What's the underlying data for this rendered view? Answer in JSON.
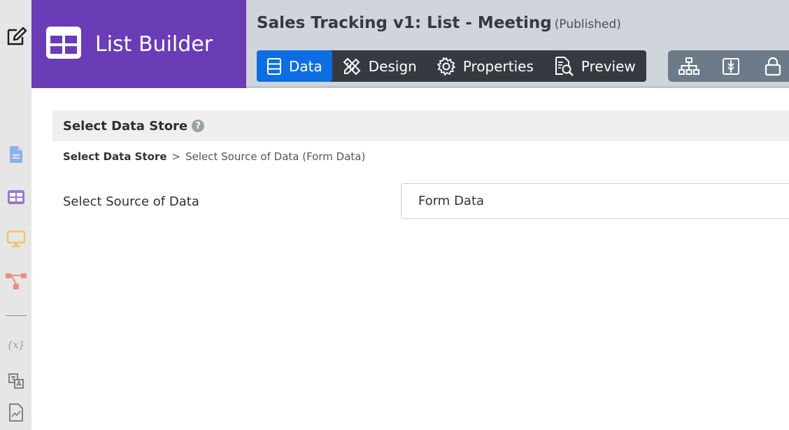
{
  "brand": {
    "title": "List Builder",
    "color": "#6a3cb5"
  },
  "document": {
    "title": "Sales Tracking v1: List - Meeting",
    "status": "(Published)"
  },
  "tabs": [
    {
      "label": "Data",
      "icon": "database-icon",
      "active": true
    },
    {
      "label": "Design",
      "icon": "design-tools-icon",
      "active": false
    },
    {
      "label": "Properties",
      "icon": "gear-icon",
      "active": false
    },
    {
      "label": "Preview",
      "icon": "preview-icon",
      "active": false
    }
  ],
  "tools": [
    {
      "icon": "hierarchy-icon"
    },
    {
      "icon": "book-icon"
    },
    {
      "icon": "lock-icon"
    }
  ],
  "rail": {
    "items": [
      {
        "icon": "edit-icon"
      },
      {
        "icon": "document-icon"
      },
      {
        "icon": "list-icon"
      },
      {
        "icon": "monitor-icon"
      },
      {
        "icon": "workflow-icon"
      },
      {
        "icon": "variable-icon",
        "text": "{x}"
      },
      {
        "icon": "translate-icon"
      },
      {
        "icon": "report-icon"
      }
    ]
  },
  "section": {
    "title": "Select Data Store"
  },
  "breadcrumb": {
    "link": "Select Data Store",
    "separator": ">",
    "current": "Select Source of Data (Form Data)"
  },
  "field": {
    "label": "Select Source of Data",
    "value": "Form Data"
  },
  "colors": {
    "accent": "#0d6ee3",
    "tabbar": "#343a40",
    "toolbar": "#6c7a89"
  }
}
